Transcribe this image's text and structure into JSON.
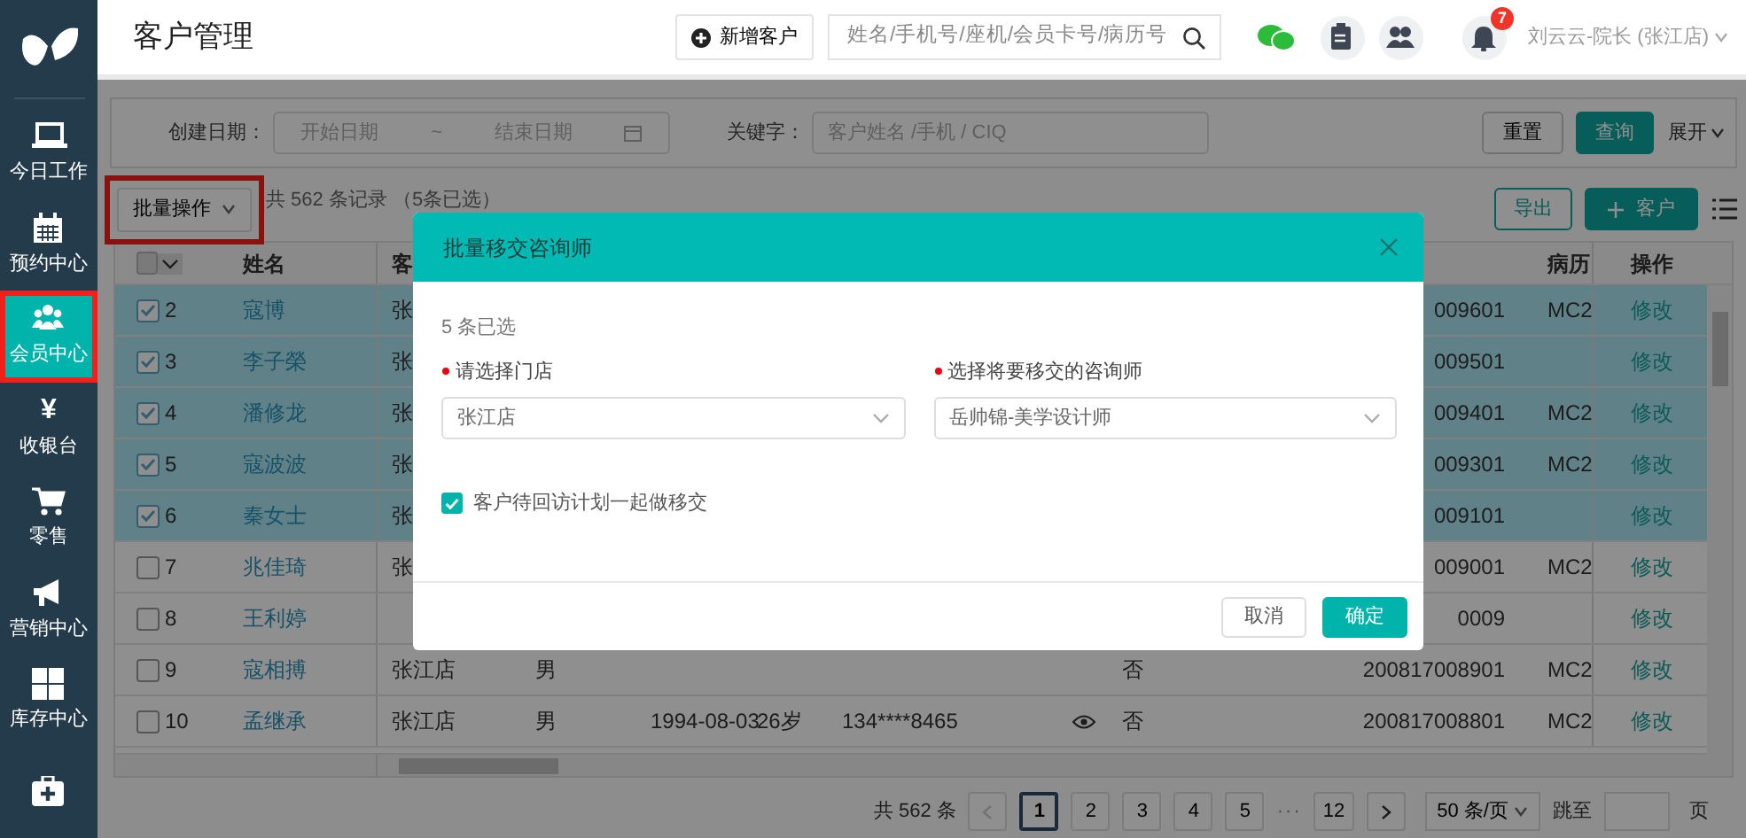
{
  "sidebar": {
    "items": [
      {
        "kind": "laptop",
        "label": "今日工作",
        "selected": false,
        "highlighted": false
      },
      {
        "kind": "calendar",
        "label": "预约中心",
        "selected": false,
        "highlighted": false
      },
      {
        "kind": "people",
        "label": "会员中心",
        "selected": true,
        "highlighted": true
      },
      {
        "kind": "char",
        "icon_text": "¥",
        "label": "收银台",
        "selected": false,
        "highlighted": false
      },
      {
        "kind": "cart",
        "label": "零售",
        "selected": false,
        "highlighted": false
      },
      {
        "kind": "megaphone",
        "label": "营销中心",
        "selected": false,
        "highlighted": false
      },
      {
        "kind": "grid",
        "label": "库存中心",
        "selected": false,
        "highlighted": false
      },
      {
        "kind": "kit",
        "selected": false,
        "highlighted": false
      }
    ]
  },
  "header": {
    "title": "客户管理",
    "add_button": "新增客户",
    "search": {
      "placeholder": "姓名/手机号/座机/会员卡号/病历号"
    },
    "notification_count": "7",
    "user": "刘云云-院长 (张江店)"
  },
  "filter": {
    "date_label": "创建日期：",
    "start_placeholder": "开始日期",
    "separator": "~",
    "end_placeholder": "结束日期",
    "keyword_label": "关键字：",
    "keyword_placeholder": "客户姓名 /手机 / CIQ",
    "reset": "重置",
    "search": "查询",
    "expand": "展开"
  },
  "toolbar": {
    "batch": {
      "label": "批量操作",
      "highlighted": true
    },
    "summary": "共 562 条记录 （5条已选）",
    "export": "导出",
    "add": "客户"
  },
  "table": {
    "select_all": {
      "checked": false
    },
    "columns": [
      {
        "label": "姓名"
      },
      {
        "label": "客"
      },
      {
        "label": "病历"
      },
      {
        "label": "操作"
      }
    ],
    "rows": [
      {
        "num": "2",
        "name": "寇博",
        "store": "张",
        "card": "009601",
        "record": "MC2",
        "action": "修改",
        "checked": true
      },
      {
        "num": "3",
        "name": "李子榮",
        "store": "张",
        "card": "009501",
        "action": "修改",
        "checked": true
      },
      {
        "num": "4",
        "name": "潘修龙",
        "store": "张",
        "card": "009401",
        "record": "MC2",
        "action": "修改",
        "checked": true
      },
      {
        "num": "5",
        "name": "寇波波",
        "store": "张",
        "card": "009301",
        "record": "MC2",
        "action": "修改",
        "checked": true
      },
      {
        "num": "6",
        "name": "秦女士",
        "store": "张",
        "card": "009101",
        "action": "修改",
        "checked": true
      },
      {
        "num": "7",
        "name": "兆佳琦",
        "store": "张",
        "card": "009001",
        "record": "MC2",
        "action": "修改",
        "checked": false
      },
      {
        "num": "8",
        "name": "王利婷",
        "card": "0009",
        "action": "修改",
        "checked": false
      },
      {
        "num": "9",
        "name": "寇相搏",
        "store": "张江店",
        "gender": "男",
        "returning": "否",
        "card": "200817008901",
        "record": "MC2",
        "action": "修改",
        "checked": false
      },
      {
        "num": "10",
        "name": "孟继承",
        "store": "张江店",
        "gender": "男",
        "birthday": "1994-08-03",
        "age": "26岁",
        "phone": "134****8465",
        "show_eye": true,
        "returning": "否",
        "card": "200817008801",
        "record": "MC2",
        "action": "修改",
        "checked": false
      }
    ]
  },
  "pagination": {
    "total": "共 562 条",
    "prev_disabled": true,
    "pages": [
      {
        "label": "1",
        "selected": true
      },
      {
        "label": "2",
        "selected": false
      },
      {
        "label": "3",
        "selected": false
      },
      {
        "label": "4",
        "selected": false
      },
      {
        "label": "5",
        "selected": false
      },
      {
        "label": "···",
        "kind": "ellipsis"
      },
      {
        "label": "12",
        "selected": false
      }
    ],
    "page_size": "50 条/页",
    "jump_label": "跳至",
    "page_unit": "页"
  },
  "modal": {
    "title": "批量移交咨询师",
    "selected_count": "5 条已选",
    "fields": [
      {
        "label": "请选择门店",
        "required": true,
        "value": "张江店"
      },
      {
        "label": "选择将要移交的咨询师",
        "required": true,
        "value": "岳帅锦-美学设计师"
      }
    ],
    "option": {
      "label": "客户待回访计划一起做移交",
      "checked": true
    },
    "buttons": [
      {
        "label": "取消",
        "kind": "secondary"
      },
      {
        "label": "确定",
        "kind": "primary"
      }
    ]
  }
}
